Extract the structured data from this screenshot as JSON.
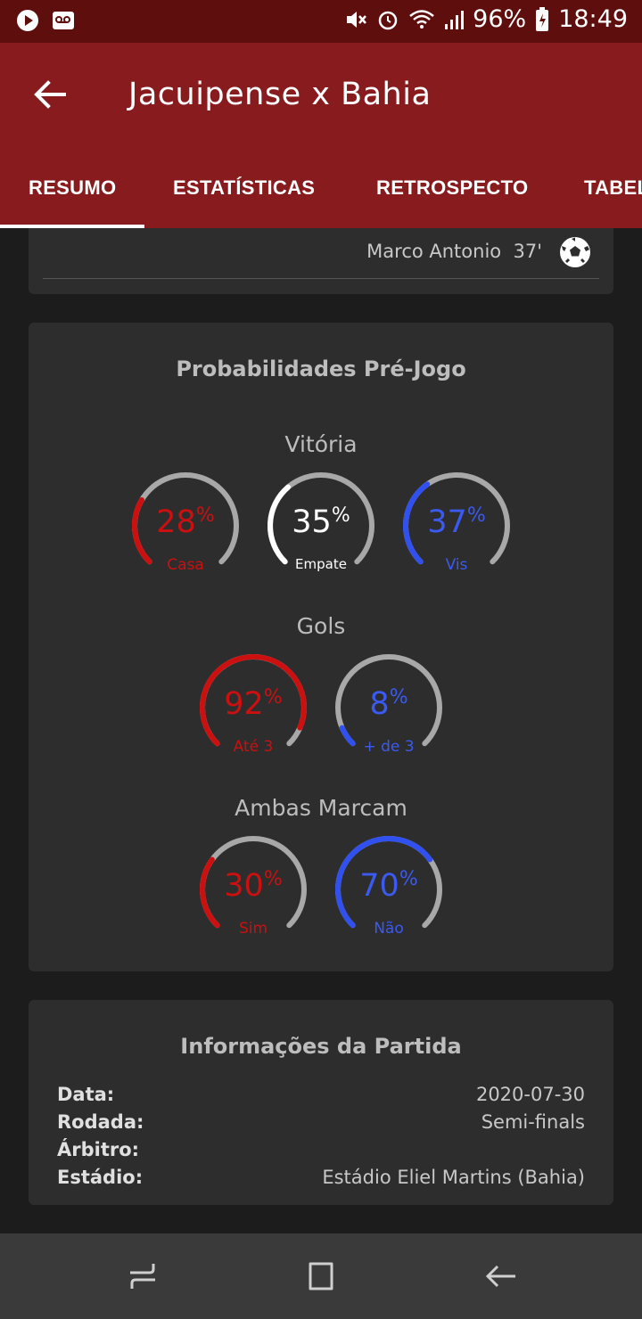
{
  "status_bar": {
    "battery": "96%",
    "time": "18:49",
    "icons": [
      "play-icon",
      "voicemail-icon",
      "mute-icon",
      "alarm-icon",
      "wifi-icon",
      "signal-icon",
      "battery-icon"
    ]
  },
  "app_bar": {
    "title": "Jacuipense x Bahia",
    "back_icon": "arrow-left-icon",
    "tabs": [
      {
        "label": "RESUMO",
        "active": true
      },
      {
        "label": "ESTATÍSTICAS",
        "active": false
      },
      {
        "label": "RETROSPECTO",
        "active": false
      },
      {
        "label": "TABEL",
        "active": false
      }
    ]
  },
  "events": [
    {
      "player": "Marco Antonio",
      "minute": "37'",
      "icon": "soccer-ball-icon"
    }
  ],
  "probabilities": {
    "title": "Probabilidades Pré-Jogo",
    "sections": [
      {
        "title": "Vitória",
        "gauges": [
          {
            "value": "28",
            "unit": "%",
            "label": "Casa",
            "fraction": 0.28,
            "color": "#cc1010",
            "text_color": "#cc1010"
          },
          {
            "value": "35",
            "unit": "%",
            "label": "Empate",
            "fraction": 0.35,
            "color": "#ffffff",
            "text_color": "#ffffff"
          },
          {
            "value": "37",
            "unit": "%",
            "label": "Vis",
            "fraction": 0.37,
            "color": "#3050f0",
            "text_color": "#3a5af0"
          }
        ]
      },
      {
        "title": "Gols",
        "gauges": [
          {
            "value": "92",
            "unit": "%",
            "label": "Até 3",
            "fraction": 0.92,
            "color": "#cc1010",
            "text_color": "#cc1010"
          },
          {
            "value": "8",
            "unit": "%",
            "label": "+ de 3",
            "fraction": 0.08,
            "color": "#3050f0",
            "text_color": "#3a5af0"
          }
        ]
      },
      {
        "title": "Ambas Marcam",
        "gauges": [
          {
            "value": "30",
            "unit": "%",
            "label": "Sim",
            "fraction": 0.3,
            "color": "#cc1010",
            "text_color": "#cc1010"
          },
          {
            "value": "70",
            "unit": "%",
            "label": "Não",
            "fraction": 0.7,
            "color": "#3050f0",
            "text_color": "#3a5af0"
          }
        ]
      }
    ]
  },
  "match_info": {
    "title": "Informações da Partida",
    "rows": [
      {
        "key": "Data:",
        "value": "2020-07-30"
      },
      {
        "key": "Rodada:",
        "value": "Semi-finals"
      },
      {
        "key": "Árbitro:",
        "value": ""
      },
      {
        "key": "Estádio:",
        "value": "Estádio Eliel Martins (Bahia)"
      }
    ]
  },
  "nav_bar": {
    "icons": [
      "recents-icon",
      "home-icon",
      "back-icon"
    ]
  },
  "colors": {
    "status_bar": "#5f0e0e",
    "app_bar": "#871b1d",
    "background": "#1c1c1c",
    "card": "#2d2d2d",
    "gauge_track": "#a8a8a8"
  }
}
